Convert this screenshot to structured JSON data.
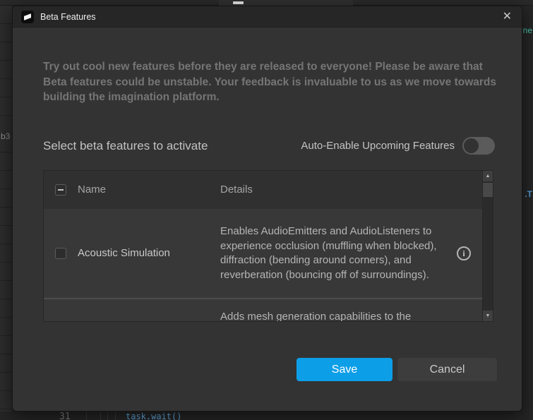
{
  "titlebar": {
    "title": "Beta Features"
  },
  "icons": {
    "close": "✕",
    "info": "i",
    "scroll_up": "▲",
    "scroll_down": "▼"
  },
  "intro": {
    "text": "Try out cool new features before they are released to everyone! Please be aware that Beta features could be unstable. Your feedback is invaluable to us as we move towards building the imagination platform."
  },
  "select_section": {
    "heading": "Select beta features to activate",
    "auto_enable_label": "Auto-Enable Upcoming Features",
    "auto_enable_on": false
  },
  "table": {
    "header": {
      "name": "Name",
      "details": "Details",
      "select_all_state": "indeterminate"
    },
    "rows": [
      {
        "name": "Acoustic Simulation",
        "checked": false,
        "details": "Enables AudioEmitters and AudioListeners to experience occlusion (muffling when blocked), diffraction (bending around corners), and reverberation (bouncing off of surroundings)."
      },
      {
        "details_partial": "Adds mesh generation capabilities to the Assistant"
      }
    ]
  },
  "footer": {
    "save_label": "Save",
    "cancel_label": "Cancel"
  },
  "colors": {
    "accent_blue": "#0d9ee8",
    "code_blue": "#5fa8dc",
    "code_teal": "#4ec9b0"
  },
  "background": {
    "explorer_partial_text": "b3",
    "right_top_text": "ne",
    "right_mid_text": ".T",
    "code_line_number": "31",
    "code_snippet": "task.wait()"
  }
}
